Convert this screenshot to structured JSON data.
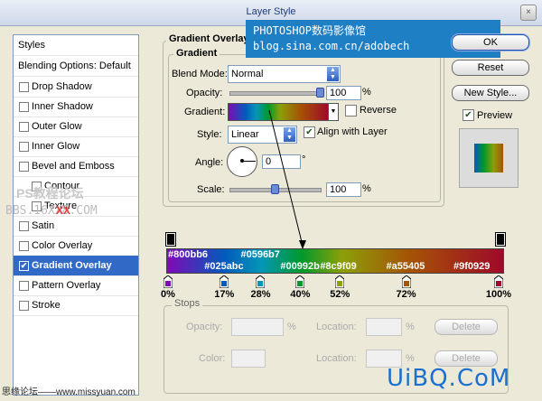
{
  "window": {
    "title": "Layer Style",
    "close_label": "×"
  },
  "banner": {
    "line1": "PHOTOSHOP数码影像馆",
    "line2": "blog.sina.com.cn/adobech"
  },
  "sidebar": {
    "header": "Styles",
    "blending": "Blending Options: Default",
    "items": [
      {
        "label": "Drop Shadow",
        "checked": false
      },
      {
        "label": "Inner Shadow",
        "checked": false
      },
      {
        "label": "Outer Glow",
        "checked": false
      },
      {
        "label": "Inner Glow",
        "checked": false
      },
      {
        "label": "Bevel and Emboss",
        "checked": false
      },
      {
        "label": "Contour",
        "checked": false
      },
      {
        "label": "Texture",
        "checked": false
      },
      {
        "label": "Satin",
        "checked": false
      },
      {
        "label": "Color Overlay",
        "checked": false
      },
      {
        "label": "Gradient Overlay",
        "checked": true
      },
      {
        "label": "Pattern Overlay",
        "checked": false
      },
      {
        "label": "Stroke",
        "checked": false
      }
    ],
    "check_mark": "✔"
  },
  "panel": {
    "group_title": "Gradient Overlay",
    "sub_title": "Gradient",
    "blend_mode_label": "Blend Mode:",
    "blend_mode_value": "Normal",
    "opacity_label": "Opacity:",
    "opacity_value": "100",
    "opacity_unit": "%",
    "opacity_level": 1.0,
    "gradient_label": "Gradient:",
    "reverse_label": "Reverse",
    "reverse_checked": false,
    "style_label": "Style:",
    "style_value": "Linear",
    "align_label": "Align with Layer",
    "align_checked": true,
    "angle_label": "Angle:",
    "angle_value": "0",
    "angle_unit": "°",
    "scale_label": "Scale:",
    "scale_value": "100",
    "scale_unit": "%",
    "scale_level": 0.5
  },
  "right": {
    "ok_label": "OK",
    "reset_label": "Reset",
    "new_style_label": "New Style...",
    "preview_label": "Preview",
    "preview_checked": true
  },
  "gradient_editor": {
    "stops": [
      {
        "hex": "#800bb6",
        "pct": "0%",
        "color": "#800bb6"
      },
      {
        "hex": "#025abc",
        "pct": "17%",
        "color": "#025abc"
      },
      {
        "hex": "#0596b7",
        "pct": "28%",
        "color": "#0596b7"
      },
      {
        "hex": "#00992b",
        "pct": "40%",
        "color": "#00992b"
      },
      {
        "hex": "#8c9f09",
        "pct": "52%",
        "color": "#8c9f09"
      },
      {
        "hex": "#a55405",
        "pct": "72%",
        "color": "#a55405"
      },
      {
        "hex": "#9f0929",
        "pct": "100%",
        "color": "#9f0929"
      }
    ],
    "stops_title": "Stops",
    "opacity_label": "Opacity:",
    "opacity_unit": "%",
    "location_label": "Location:",
    "location_unit": "%",
    "color_label": "Color:",
    "delete_label": "Delete"
  },
  "watermarks": {
    "left_top": "PS教程论坛",
    "left_bottom": "BBS.16XX8.COM",
    "left_xx": "XX",
    "bottom_left": "思缘论坛——www.missyuan.com",
    "bottom_right": "UiBQ.CoM"
  },
  "colors": {
    "accent": "#3169c6",
    "banner": "#1f7fc4",
    "brand": "#1a6fd1"
  }
}
